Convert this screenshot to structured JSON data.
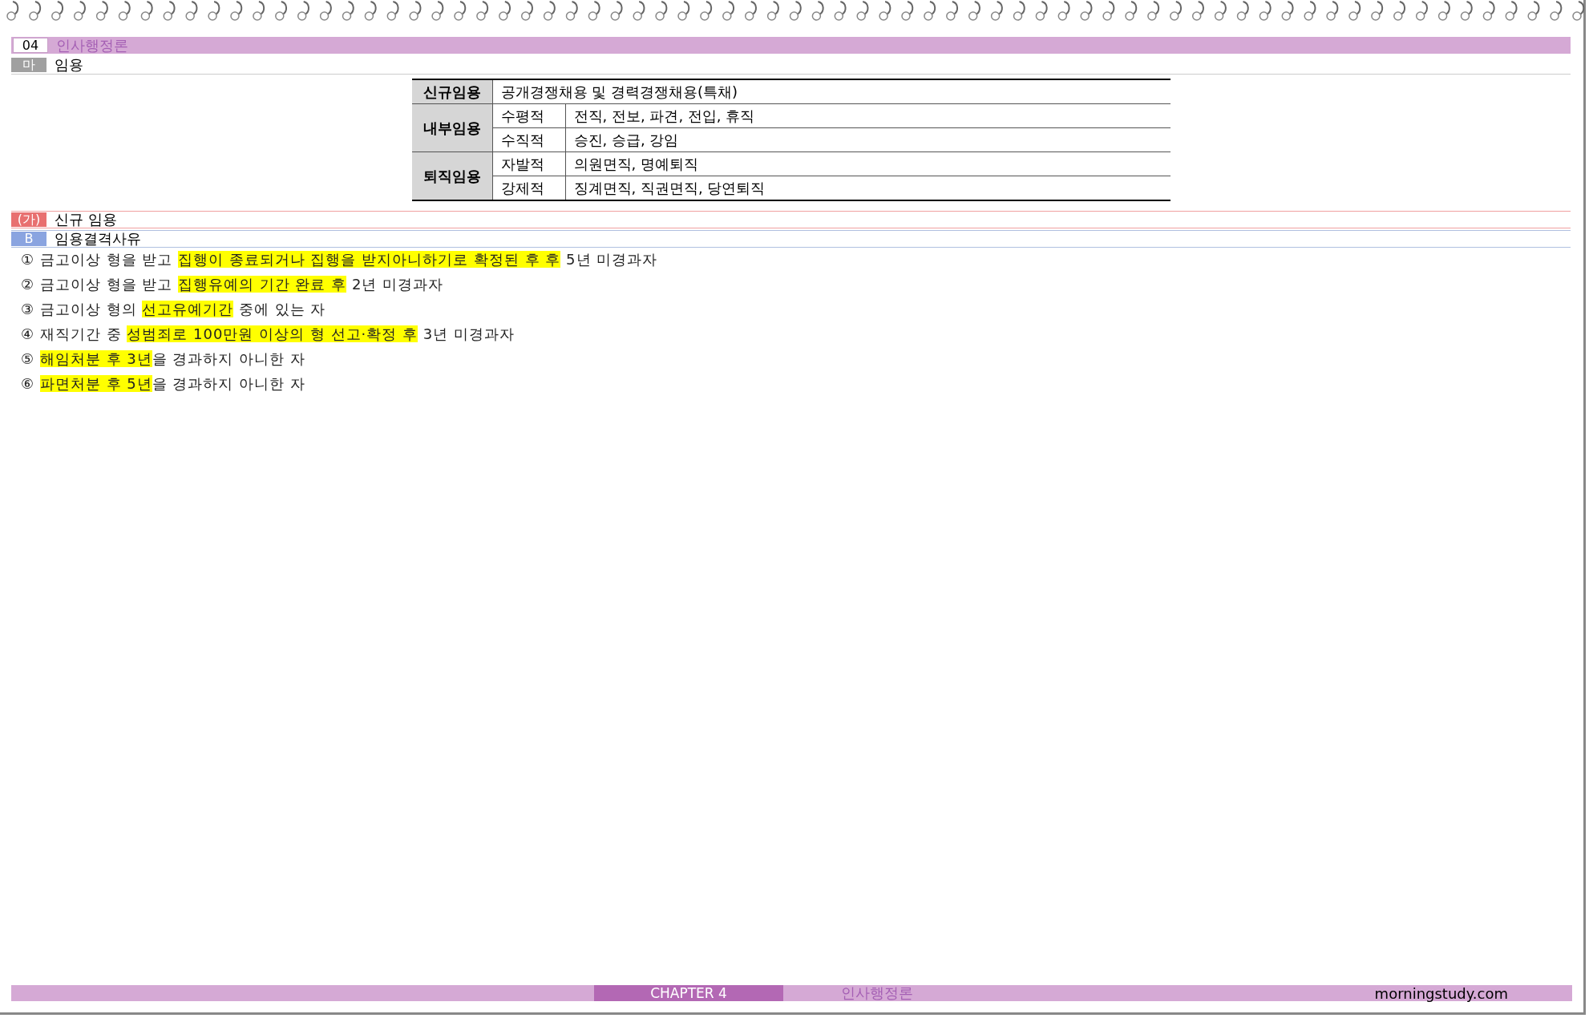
{
  "chapter_header": {
    "number": "04",
    "title": "인사행정론"
  },
  "section": {
    "marker": "마",
    "title": "임용"
  },
  "table": {
    "groups": [
      {
        "label": "신규임용",
        "rows": [
          {
            "value": "공개경쟁채용 및 경력경쟁채용(특채)"
          }
        ]
      },
      {
        "label": "내부임용",
        "rows": [
          {
            "type": "수평적",
            "value": "전직, 전보, 파견, 전입, 휴직"
          },
          {
            "type": "수직적",
            "value": "승진, 승급, 강임"
          }
        ]
      },
      {
        "label": "퇴직임용",
        "rows": [
          {
            "type": "자발적",
            "value": "의원면직, 명예퇴직"
          },
          {
            "type": "강제적",
            "value": "징계면직, 직권면직, 당연퇴직"
          }
        ]
      }
    ]
  },
  "subsection": {
    "marker": "(가)",
    "title": "신규 임용"
  },
  "subsubsection": {
    "marker": "B",
    "title": "임용결격사유"
  },
  "items": [
    {
      "number": "①",
      "segments": [
        {
          "text": "금고이상 형을 받고 ",
          "highlight": false
        },
        {
          "text": "집행이 종료되거나 집행을 받지아니하기로 확정된 후 후",
          "highlight": true
        },
        {
          "text": " 5년 미경과자",
          "highlight": false
        }
      ]
    },
    {
      "number": "②",
      "segments": [
        {
          "text": "금고이상 형을 받고 ",
          "highlight": false
        },
        {
          "text": "집행유예의 기간 완료 후",
          "highlight": true
        },
        {
          "text": " 2년 미경과자",
          "highlight": false
        }
      ]
    },
    {
      "number": "③",
      "segments": [
        {
          "text": "금고이상 형의 ",
          "highlight": false
        },
        {
          "text": "선고유예기간",
          "highlight": true
        },
        {
          "text": " 중에 있는 자",
          "highlight": false
        }
      ]
    },
    {
      "number": "④",
      "segments": [
        {
          "text": "재직기간 중 ",
          "highlight": false
        },
        {
          "text": "성범죄로 100만원 이상의 형 선고·확정 후",
          "highlight": true
        },
        {
          "text": " 3년 미경과자",
          "highlight": false
        }
      ]
    },
    {
      "number": "⑤",
      "segments": [
        {
          "text": "해임처분 후 ",
          "highlight": true
        },
        {
          "text": "3년",
          "highlight": true
        },
        {
          "text": "을 경과하지 아니한 자",
          "highlight": false
        }
      ]
    },
    {
      "number": "⑥",
      "segments": [
        {
          "text": "파면처분 후 ",
          "highlight": true
        },
        {
          "text": "5년",
          "highlight": true
        },
        {
          "text": "을 경과하지 아니한 자",
          "highlight": false
        }
      ]
    }
  ],
  "footer": {
    "chapter": "CHAPTER 4",
    "title": "인사행정론",
    "site": "morningstudy.com"
  }
}
